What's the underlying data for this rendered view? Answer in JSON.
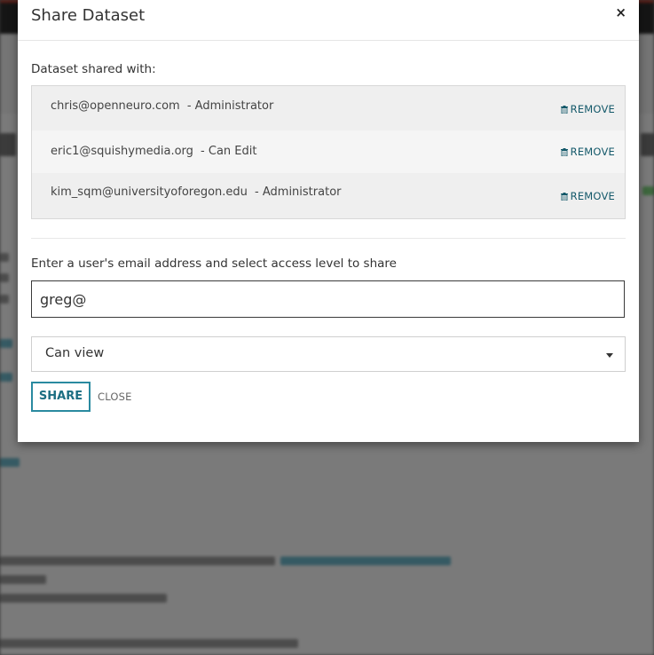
{
  "modal": {
    "title": "Share Dataset",
    "close_glyph": "×",
    "shared_with_label": "Dataset shared with:",
    "shared_users": [
      {
        "email": "chris@openneuro.com",
        "role": "- Administrator",
        "remove_label": "REMOVE"
      },
      {
        "email": "eric1@squishymedia.org",
        "role": "- Can Edit",
        "remove_label": "REMOVE"
      },
      {
        "email": "kim_sqm@universityoforegon.edu",
        "role": "- Administrator",
        "remove_label": "REMOVE"
      }
    ],
    "invite_label": "Enter a user's email address and select access level to share",
    "email_input_value": "greg@",
    "access_level_selected": "Can view",
    "share_button_label": "SHARE",
    "close_button_label": "CLOSE"
  },
  "colors": {
    "accent": "#2a8aa0",
    "remove_link": "#14596a",
    "overlay": "rgba(0,0,0,0.5)"
  }
}
